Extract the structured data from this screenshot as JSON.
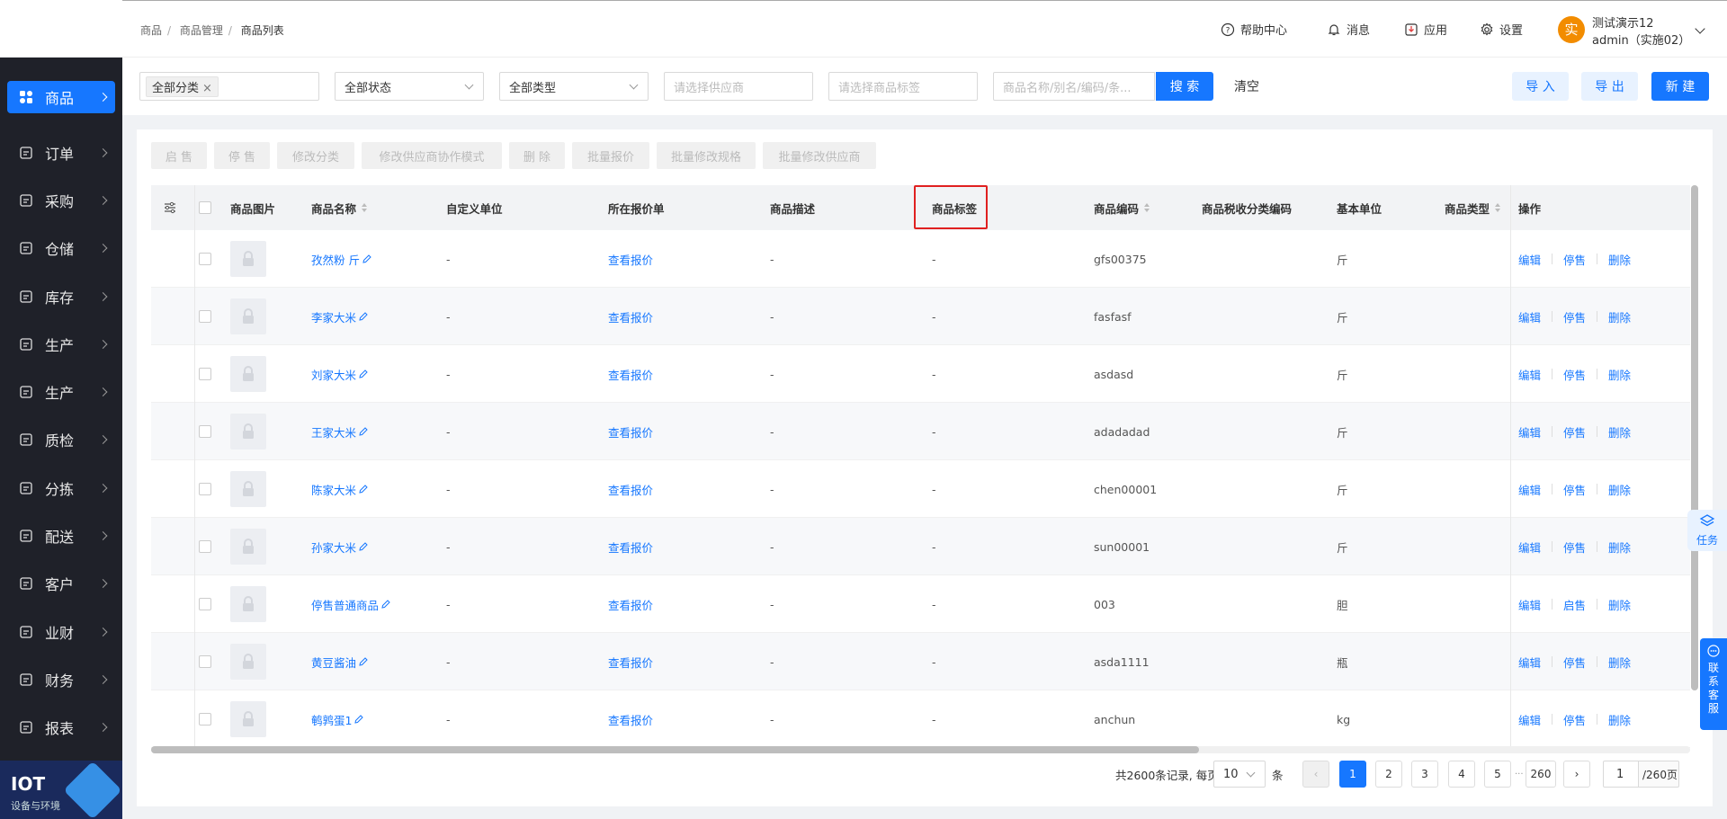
{
  "breadcrumb": [
    "商品",
    "商品管理",
    "商品列表"
  ],
  "header": {
    "help": "帮助中心",
    "messages": "消息",
    "apps": "应用",
    "settings": "设置",
    "avatar_char": "实",
    "user_name": "测试演示12",
    "user_account": "admin（实施02）"
  },
  "sidebar": {
    "items": [
      {
        "label": "商品",
        "icon": "goods-icon",
        "active": true
      },
      {
        "label": "订单",
        "icon": "order-icon"
      },
      {
        "label": "采购",
        "icon": "purchase-icon"
      },
      {
        "label": "仓储",
        "icon": "warehouse-icon"
      },
      {
        "label": "库存",
        "icon": "inventory-icon"
      },
      {
        "label": "生产",
        "icon": "factory-icon"
      },
      {
        "label": "生产",
        "icon": "production-chart-icon"
      },
      {
        "label": "质检",
        "icon": "shield-icon"
      },
      {
        "label": "分拣",
        "icon": "sorting-icon"
      },
      {
        "label": "配送",
        "icon": "truck-icon"
      },
      {
        "label": "客户",
        "icon": "customer-icon"
      },
      {
        "label": "业财",
        "icon": "finance-chart-icon"
      },
      {
        "label": "财务",
        "icon": "finance-icon"
      },
      {
        "label": "报表",
        "icon": "report-icon"
      }
    ],
    "iot_title": "IOT",
    "iot_sub": "设备与环境"
  },
  "filters": {
    "category_tag": "全部分类",
    "status": "全部状态",
    "type": "全部类型",
    "supplier_placeholder": "请选择供应商",
    "tag_placeholder": "请选择商品标签",
    "search_placeholder": "商品名称/别名/编码/条...",
    "search_btn": "搜 索",
    "clear_btn": "清空",
    "import_btn": "导 入",
    "export_btn": "导 出",
    "new_btn": "新 建"
  },
  "bulk_actions": [
    "启 售",
    "停 售",
    "修改分类",
    "修改供应商协作模式",
    "删 除",
    "批量报价",
    "批量修改规格",
    "批量修改供应商"
  ],
  "table": {
    "columns": [
      "商品图片",
      "商品名称",
      "自定义单位",
      "所在报价单",
      "商品描述",
      "商品标签",
      "商品编码",
      "商品税收分类编码",
      "基本单位",
      "商品类型",
      "操作"
    ],
    "rows": [
      {
        "name": "孜然粉 斤",
        "unit_custom": "-",
        "quote": "查看报价",
        "desc": "-",
        "tag": "-",
        "code": "gfs00375",
        "tax": "",
        "unit": "斤",
        "op2": "停售"
      },
      {
        "name": "李家大米",
        "unit_custom": "-",
        "quote": "查看报价",
        "desc": "-",
        "tag": "-",
        "code": "fasfasf",
        "tax": "",
        "unit": "斤",
        "op2": "停售"
      },
      {
        "name": "刘家大米",
        "unit_custom": "-",
        "quote": "查看报价",
        "desc": "-",
        "tag": "-",
        "code": "asdasd",
        "tax": "",
        "unit": "斤",
        "op2": "停售"
      },
      {
        "name": "王家大米",
        "unit_custom": "-",
        "quote": "查看报价",
        "desc": "-",
        "tag": "-",
        "code": "adadadad",
        "tax": "",
        "unit": "斤",
        "op2": "停售"
      },
      {
        "name": "陈家大米",
        "unit_custom": "-",
        "quote": "查看报价",
        "desc": "-",
        "tag": "-",
        "code": "chen00001",
        "tax": "",
        "unit": "斤",
        "op2": "停售"
      },
      {
        "name": "孙家大米",
        "unit_custom": "-",
        "quote": "查看报价",
        "desc": "-",
        "tag": "-",
        "code": "sun00001",
        "tax": "",
        "unit": "斤",
        "op2": "停售"
      },
      {
        "name": "停售普通商品",
        "unit_custom": "-",
        "quote": "查看报价",
        "desc": "-",
        "tag": "-",
        "code": "003",
        "tax": "",
        "unit": "胆",
        "op2": "启售"
      },
      {
        "name": "黄豆酱油",
        "unit_custom": "-",
        "quote": "查看报价",
        "desc": "-",
        "tag": "-",
        "code": "asda1111",
        "tax": "",
        "unit": "瓶",
        "op2": "停售"
      },
      {
        "name": "鹌鹑蛋1",
        "unit_custom": "-",
        "quote": "查看报价",
        "desc": "-",
        "tag": "-",
        "code": "anchun",
        "tax": "",
        "unit": "kg",
        "op2": "停售"
      }
    ],
    "op_edit": "编辑",
    "op_delete": "删除"
  },
  "pagination": {
    "total_text": "共2600条记录, 每页",
    "page_size": "10",
    "unit": "条",
    "pages": [
      "1",
      "2",
      "3",
      "4",
      "5"
    ],
    "ellipsis": "···",
    "last": "260",
    "jump_value": "1",
    "jump_total": "/260页"
  },
  "float": {
    "task": "任务",
    "cs": [
      "联",
      "系",
      "客",
      "服"
    ]
  },
  "colors": {
    "primary": "#1677ff",
    "sidebar": "#1f2129",
    "highlight": "#e02020"
  }
}
